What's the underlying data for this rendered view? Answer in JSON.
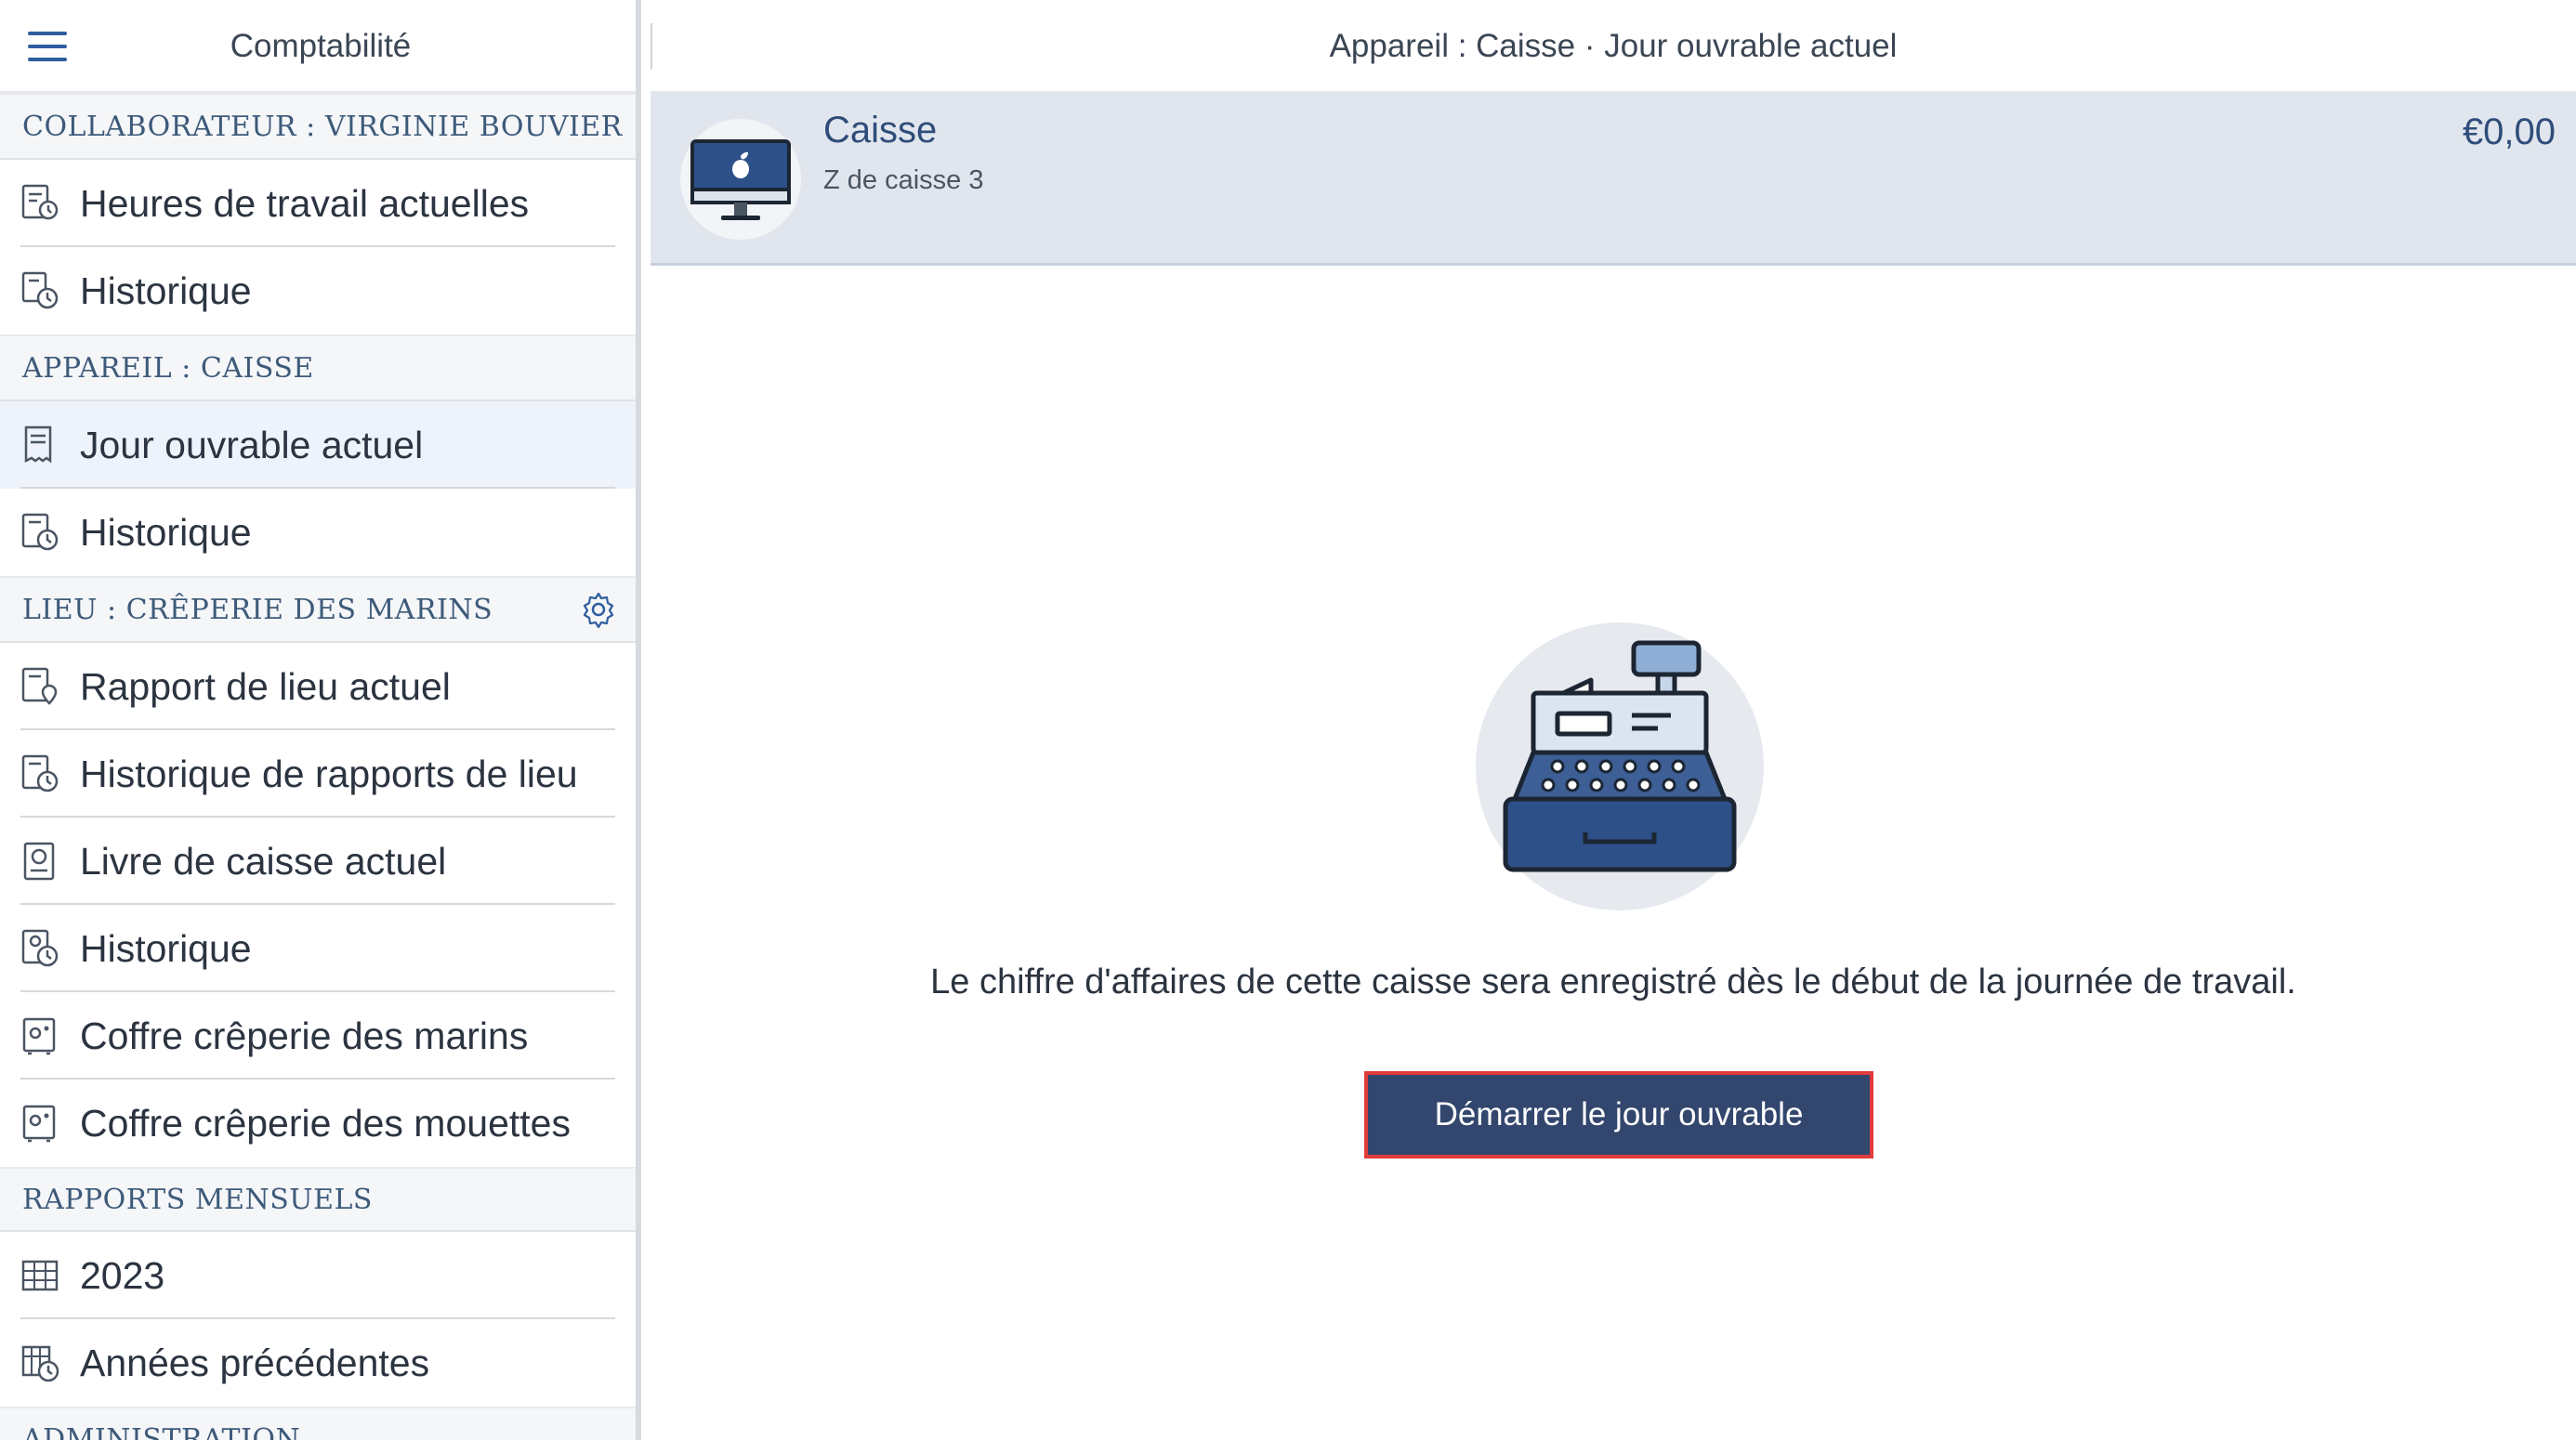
{
  "sidebar": {
    "title": "Comptabilité",
    "sections": [
      {
        "header": "COLLABORATEUR : VIRGINIE BOUVIER",
        "items": [
          {
            "label": "Heures de travail actuelles",
            "icon": "timesheet-icon"
          },
          {
            "label": "Historique",
            "icon": "history-icon"
          }
        ]
      },
      {
        "header": "APPAREIL : CAISSE",
        "items": [
          {
            "label": "Jour ouvrable actuel",
            "icon": "receipt-icon",
            "active": true
          },
          {
            "label": "Historique",
            "icon": "receipt-history-icon"
          }
        ]
      },
      {
        "header": "LIEU : CRÊPERIE DES MARINS",
        "header_icon": "gear-icon",
        "items": [
          {
            "label": "Rapport de lieu actuel",
            "icon": "location-report-icon"
          },
          {
            "label": "Historique de rapports de lieu",
            "icon": "location-history-icon"
          },
          {
            "label": "Livre de caisse actuel",
            "icon": "cashbook-icon"
          },
          {
            "label": "Historique",
            "icon": "cashbook-history-icon"
          },
          {
            "label": "Coffre crêperie des marins",
            "icon": "safe-icon"
          },
          {
            "label": "Coffre crêperie des mouettes",
            "icon": "safe-icon"
          }
        ]
      },
      {
        "header": "RAPPORTS MENSUELS",
        "items": [
          {
            "label": "2023",
            "icon": "calendar-grid-icon"
          },
          {
            "label": "Années précédentes",
            "icon": "calendar-history-icon"
          }
        ]
      },
      {
        "header": "ADMINISTRATION",
        "items": []
      }
    ]
  },
  "main": {
    "title": "Appareil : Caisse · Jour ouvrable actuel",
    "device": {
      "name": "Caisse",
      "subtitle": "Z de caisse 3",
      "amount": "€0,00",
      "icon": "imac-icon"
    },
    "empty_state": {
      "illustration": "cash-register-icon",
      "message": "Le chiffre d'affaires de cette caisse sera enregistré dès le début de la journée de travail.",
      "button_label": "Démarrer le jour ouvrable"
    }
  },
  "colors": {
    "accent": "#32466e",
    "link": "#2f5e9e",
    "selected_row": "#e1e6ee",
    "highlight_border": "#e23b3b"
  }
}
